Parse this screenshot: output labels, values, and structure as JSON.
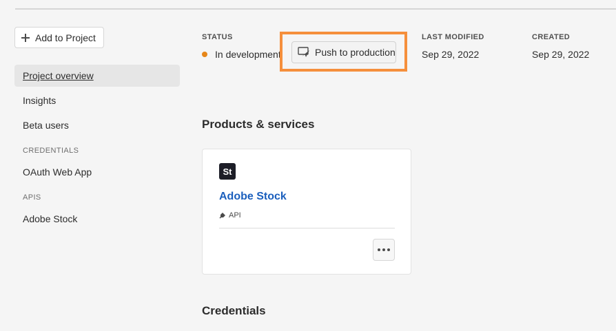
{
  "sidebar": {
    "add_button_label": "Add to Project",
    "items": [
      {
        "label": "Project overview"
      },
      {
        "label": "Insights"
      },
      {
        "label": "Beta users"
      }
    ],
    "credentials_heading": "CREDENTIALS",
    "credentials_items": [
      {
        "label": "OAuth Web App"
      }
    ],
    "apis_heading": "APIS",
    "apis_items": [
      {
        "label": "Adobe Stock"
      }
    ]
  },
  "overview": {
    "status_label": "STATUS",
    "status_value": "In development",
    "status_color": "#e68619",
    "push_button_label": "Push to production",
    "last_modified_label": "LAST MODIFIED",
    "last_modified_value": "Sep 29, 2022",
    "created_label": "CREATED",
    "created_value": "Sep 29, 2022",
    "highlight_color": "#f58f3c"
  },
  "products": {
    "heading": "Products & services",
    "cards": [
      {
        "logo_text": "St",
        "title": "Adobe Stock",
        "tag": "API",
        "title_color": "#1b5fbd"
      }
    ]
  },
  "credentials": {
    "heading": "Credentials"
  }
}
